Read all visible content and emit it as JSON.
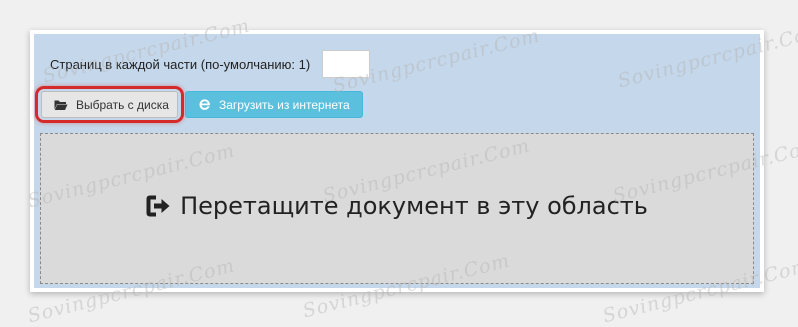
{
  "pages_per_part": {
    "label": "Страниц в каждой части (по-умолчанию: 1)",
    "value": ""
  },
  "buttons": {
    "from_disk": "Выбрать с диска",
    "from_internet": "Загрузить из интернета"
  },
  "dropzone": {
    "text": "Перетащите документ в эту область",
    "icon": "sign-in-icon"
  },
  "watermark": {
    "text": "Sovingpcrcpair.Com"
  },
  "colors": {
    "panel": "#c5d7ea",
    "dropzone": "#dadada",
    "internet_button": "#5bc0de",
    "highlight": "#d42a2a"
  }
}
